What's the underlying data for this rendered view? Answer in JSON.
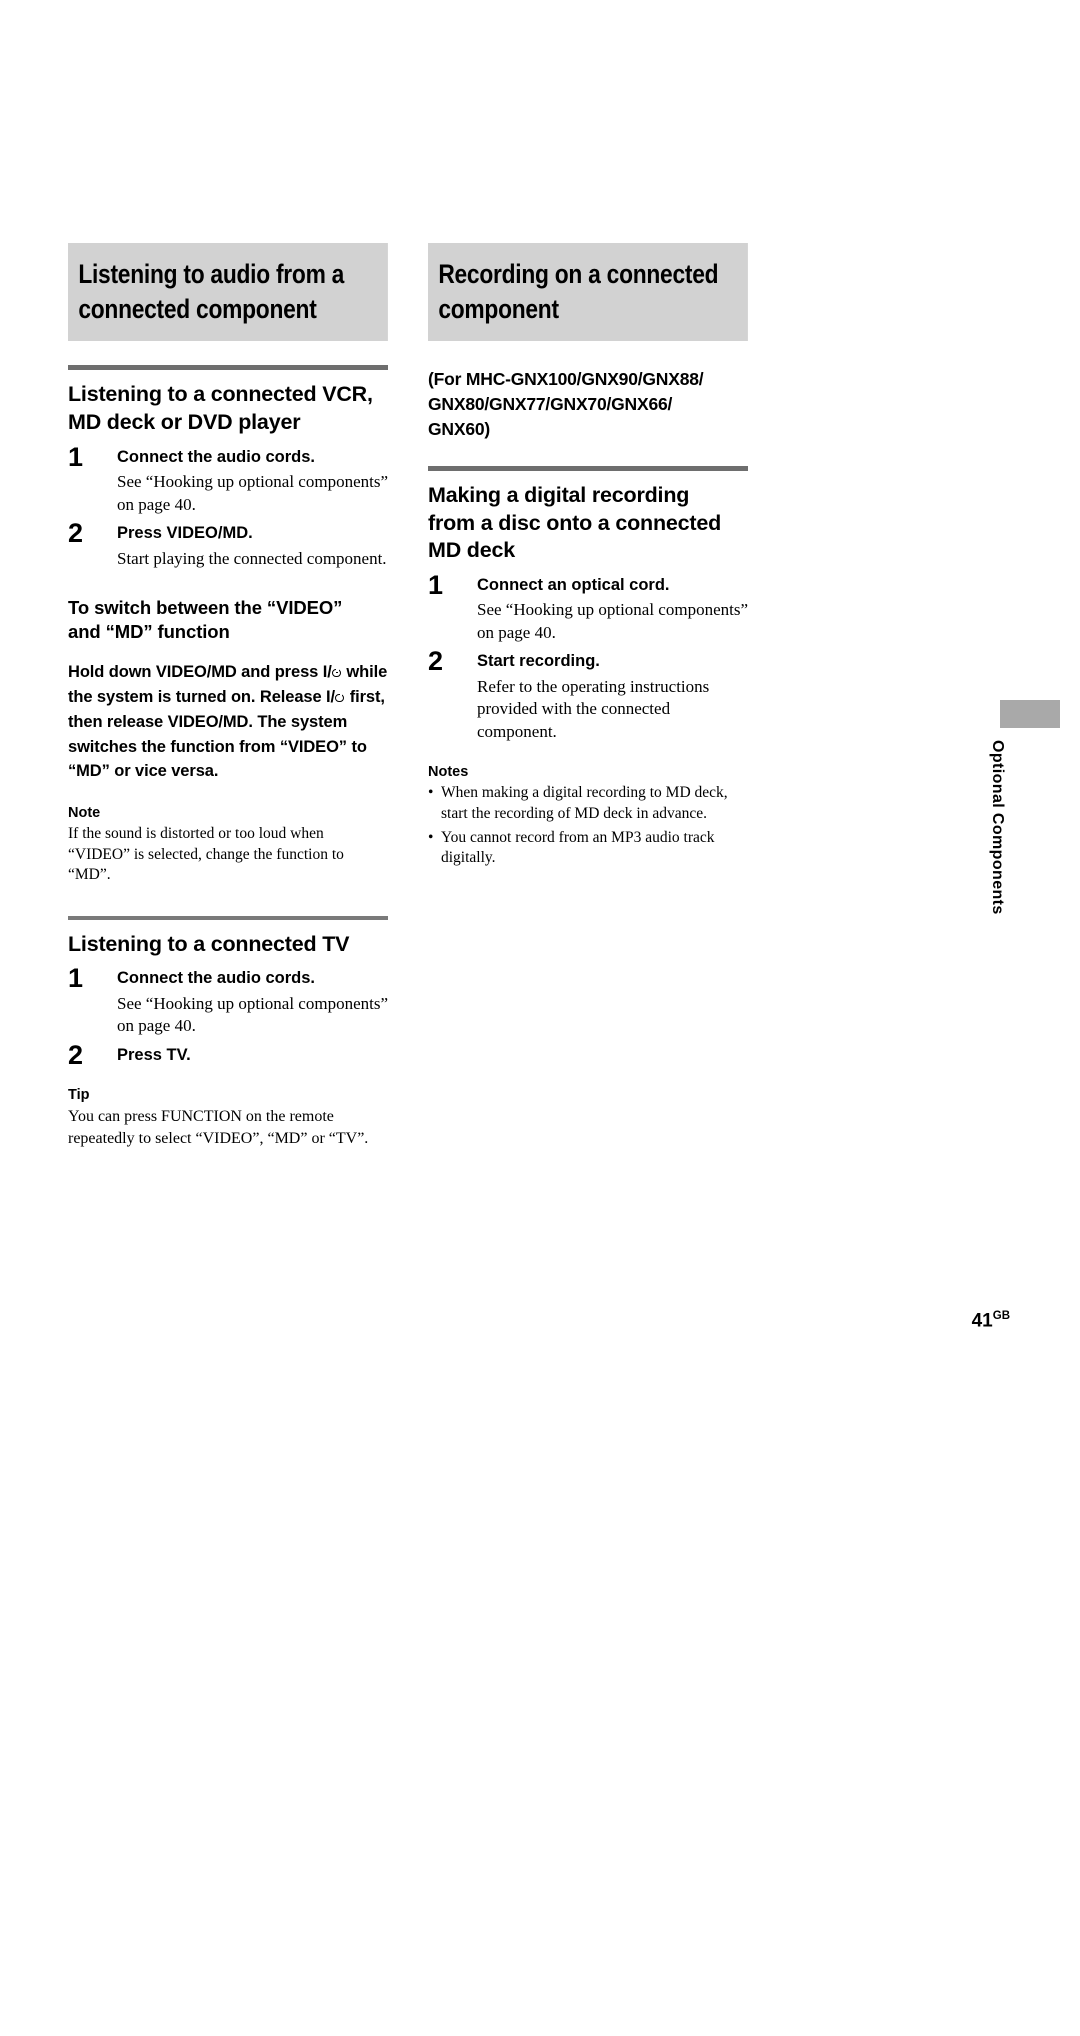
{
  "page": {
    "number": "41",
    "region_suffix": "GB",
    "side_tab_label": "Optional Components"
  },
  "left_column": {
    "banner_title_line1": "Listening to audio from a",
    "banner_title_line2": "connected component",
    "section1": {
      "heading_line1": "Listening to a connected VCR,",
      "heading_line2": "MD deck or DVD player",
      "steps": [
        {
          "num": "1",
          "title": "Connect the audio cords.",
          "body": "See “Hooking up optional components” on page 40."
        },
        {
          "num": "2",
          "title": "Press VIDEO/MD.",
          "body": "Start playing the connected component."
        }
      ],
      "subheading_line1": "To switch between the “VIDEO”",
      "subheading_line2": "and “MD” function",
      "bold_para_part1": "Hold down VIDEO/MD and press ",
      "bold_para_part2": " while the system is turned on. Release ",
      "bold_para_part3": " first, then release VIDEO/MD. The system switches the function from “VIDEO” to “MD” or vice versa.",
      "note_label": "Note",
      "note_body": "If the sound is distorted or too loud when “VIDEO” is selected, change the function to “MD”."
    },
    "section2": {
      "heading": "Listening to a connected TV",
      "steps": [
        {
          "num": "1",
          "title": "Connect the audio cords.",
          "body": "See “Hooking up optional components” on page 40."
        },
        {
          "num": "2",
          "title": "Press TV.",
          "body": ""
        }
      ],
      "tip_label": "Tip",
      "tip_body": "You can press FUNCTION on the remote repeatedly to select “VIDEO”, “MD” or “TV”."
    }
  },
  "right_column": {
    "banner_title_line1": "Recording on a connected",
    "banner_title_line2": "component",
    "model_list_line1": "(For MHC-GNX100/GNX90/GNX88/",
    "model_list_line2": "GNX80/GNX77/GNX70/GNX66/",
    "model_list_line3": "GNX60)",
    "section1": {
      "heading_line1": "Making a digital recording",
      "heading_line2": "from a disc onto a connected",
      "heading_line3": "MD deck",
      "steps": [
        {
          "num": "1",
          "title": "Connect an optical cord.",
          "body": "See “Hooking up optional components” on page 40."
        },
        {
          "num": "2",
          "title": "Start recording.",
          "body": "Refer to the operating instructions provided with the connected component."
        }
      ],
      "notes_label": "Notes",
      "notes": [
        "When making a digital recording to MD deck, start the recording of MD deck in advance.",
        "You cannot record from an MP3 audio track digitally."
      ]
    }
  },
  "colors": {
    "banner_bg": "#d2d2d2",
    "rule": "#6e6e6e",
    "side_tab": "#a9a9a9"
  }
}
